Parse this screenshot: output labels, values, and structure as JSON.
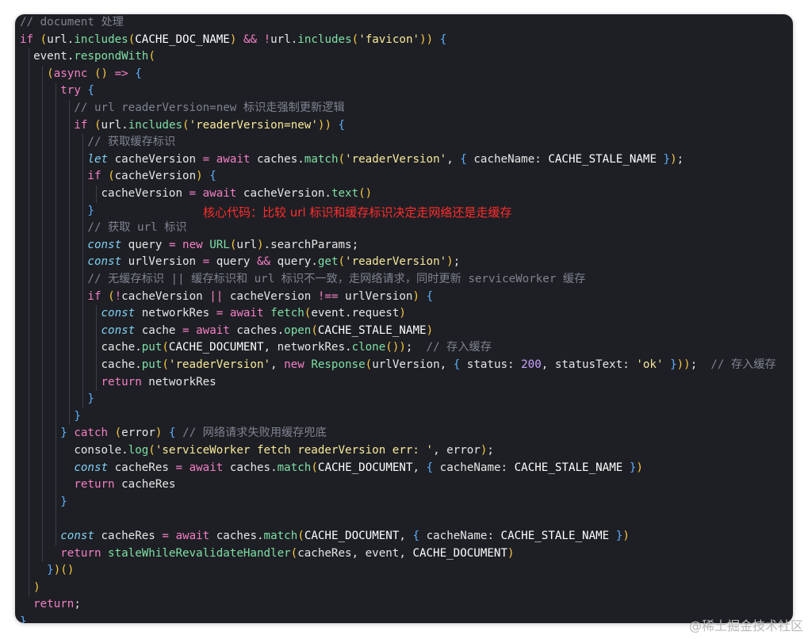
{
  "editor": {
    "lines": [
      "// document 处理",
      "if (url.includes(CACHE_DOC_NAME) && !url.includes('favicon')) {",
      "  event.respondWith(",
      "    (async () => {",
      "      try {",
      "        // url readerVersion=new 标识走强制更新逻辑",
      "        if (url.includes('readerVersion=new')) {",
      "          // 获取缓存标识",
      "          let cacheVersion = await caches.match('readerVersion', { cacheName: CACHE_STALE_NAME });",
      "          if (cacheVersion) {",
      "            cacheVersion = await cacheVersion.text()",
      "          }",
      "          // 获取 url 标识",
      "          const query = new URL(url).searchParams;",
      "          const urlVersion = query && query.get('readerVersion');",
      "          // 无缓存标识 || 缓存标识和 url 标识不一致，走网络请求，同时更新 serviceWorker 缓存",
      "          if (!cacheVersion || cacheVersion !== urlVersion) {",
      "            const networkRes = await fetch(event.request)",
      "            const cache = await caches.open(CACHE_STALE_NAME)",
      "            cache.put(CACHE_DOCUMENT, networkRes.clone());  // 存入缓存",
      "            cache.put('readerVersion', new Response(urlVersion, { status: 200, statusText: 'ok' }));  // 存入缓存",
      "            return networkRes",
      "          }",
      "        }",
      "      } catch (error) { // 网络请求失败用缓存兜底",
      "        console.log('serviceWorker fetch readerVersion err: ', error);",
      "        const cacheRes = await caches.match(CACHE_DOCUMENT, { cacheName: CACHE_STALE_NAME })",
      "        return cacheRes",
      "      }",
      "",
      "      const cacheRes = await caches.match(CACHE_DOCUMENT, { cacheName: CACHE_STALE_NAME })",
      "      return staleWhileRevalidateHandler(cacheRes, event, CACHE_DOCUMENT)",
      "    })()",
      "  )",
      "  return;",
      "}"
    ],
    "annotation": "核心代码：比较 url 标识和缓存标识决定走网络还是走缓存"
  },
  "watermark": "@稀土掘金技术社区"
}
